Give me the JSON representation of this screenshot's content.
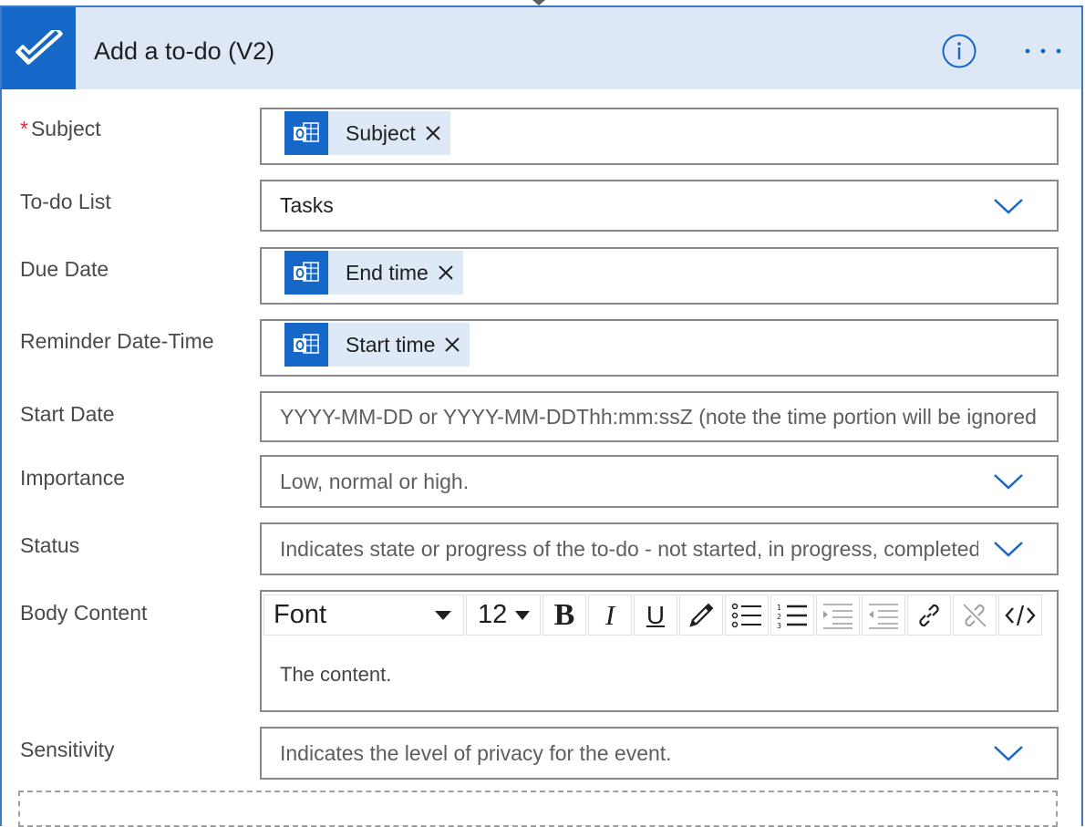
{
  "header": {
    "title": "Add a to-do (V2)",
    "app_icon": "todo-check-icon",
    "info_icon": "info-icon",
    "more_icon": "more-options-icon",
    "accent_color": "#1668c8",
    "header_bg": "#dde7f5"
  },
  "fields": {
    "subject": {
      "label": "Subject",
      "required_mark": "*",
      "token_text": "Subject",
      "token_icon": "outlook-icon"
    },
    "todo_list": {
      "label": "To-do List",
      "value": "Tasks"
    },
    "due_date": {
      "label": "Due Date",
      "token_text": "End time"
    },
    "reminder": {
      "label": "Reminder Date-Time",
      "token_text": "Start time"
    },
    "start_date": {
      "label": "Start Date",
      "placeholder": "YYYY-MM-DD or YYYY-MM-DDThh:mm:ssZ (note the time portion will be ignored"
    },
    "importance": {
      "label": "Importance",
      "placeholder": "Low, normal or high."
    },
    "status": {
      "label": "Status",
      "placeholder": "Indicates state or progress of the to-do - not started, in progress, completed"
    },
    "body": {
      "label": "Body Content",
      "font_label": "Font",
      "size_label": "12",
      "bold_label": "B",
      "italic_label": "I",
      "underline_label": "U",
      "content_placeholder": "The content."
    },
    "sensitivity": {
      "label": "Sensitivity",
      "placeholder": "Indicates the level of privacy for the event."
    }
  }
}
